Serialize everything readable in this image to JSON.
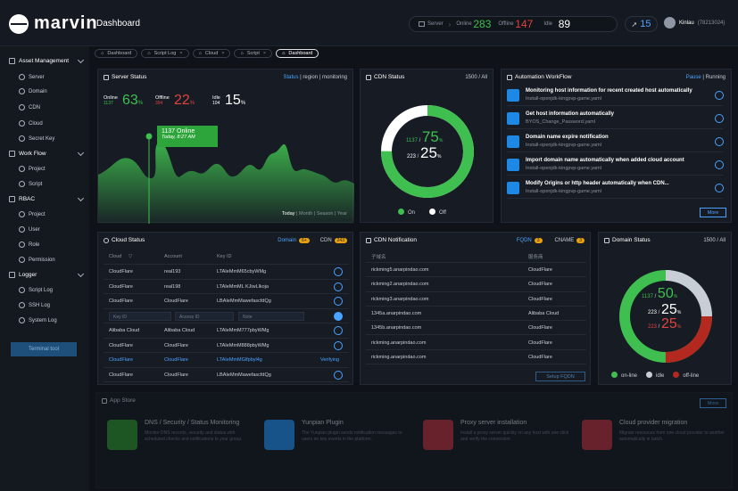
{
  "app": {
    "name": "marvin",
    "page_title": "Dashboard"
  },
  "header": {
    "server_label": "Server",
    "online_label": "Online",
    "online": "283",
    "offline_label": "Offline",
    "offline": "147",
    "idle_label": "Idle",
    "idle": "89",
    "notifications": "15",
    "user_name": "Kinlau",
    "user_phone": "(78213024)"
  },
  "sidebar": {
    "items": [
      {
        "label": "Asset Management",
        "group": true
      },
      {
        "label": "Server"
      },
      {
        "label": "Domain"
      },
      {
        "label": "CDN"
      },
      {
        "label": "Cloud"
      },
      {
        "label": "Secret Key"
      },
      {
        "label": "Work Flow",
        "group": true
      },
      {
        "label": "Project"
      },
      {
        "label": "Script"
      },
      {
        "label": "RBAC",
        "group": true
      },
      {
        "label": "Project"
      },
      {
        "label": "User"
      },
      {
        "label": "Role"
      },
      {
        "label": "Permission"
      },
      {
        "label": "Logger",
        "group": true
      },
      {
        "label": "Script Log"
      },
      {
        "label": "SSH Log"
      },
      {
        "label": "System Log"
      }
    ],
    "terminal_button": "Terminal tool"
  },
  "tabs": [
    {
      "label": "Dashboard"
    },
    {
      "label": "Script Log"
    },
    {
      "label": "Cloud"
    },
    {
      "label": "Script"
    },
    {
      "label": "Dashboard"
    }
  ],
  "server_status": {
    "title": "Server Status",
    "links": {
      "status": "Status",
      "region": "region",
      "monitoring": "monitoring"
    },
    "online": {
      "label": "Online",
      "count": "1137",
      "pct": "63"
    },
    "offline": {
      "label": "Offline",
      "count": "394",
      "pct": "22"
    },
    "idle": {
      "label": "Idle",
      "count": "104",
      "pct": "15"
    },
    "callout_value": "1137 Online",
    "callout_time": "Today, 8:27 AM",
    "ranges": {
      "today": "Today",
      "month": "Month",
      "season": "Season",
      "year": "Year"
    }
  },
  "cdn_status": {
    "title": "CDN Status",
    "count": "1500 / All",
    "on_count": "1137",
    "on_pct": "75",
    "off_count": "223",
    "off_pct": "25",
    "on_label": "On",
    "off_label": "Off",
    "on_fraction": 0.75
  },
  "automation": {
    "title": "Automation WorkFlow",
    "pause": "Pause",
    "running": "Running",
    "more": "More",
    "items": [
      {
        "title": "Monitoring host information for recent created host automatically",
        "script": "Install-openjdk-kingpvp-game.yaml"
      },
      {
        "title": "Get host information automatically",
        "script": "BYOS_Change_Password.yaml"
      },
      {
        "title": "Domain name expire notification",
        "script": "Install-openjdk-kingpvp-game.yaml"
      },
      {
        "title": "Import domain name automatically when added cloud account",
        "script": "Install-openjdk-kingpvp-game.yaml"
      },
      {
        "title": "Modify Origins or http header automatically when CDN...",
        "script": "Install-openjdk-kingpvp-game.yaml"
      }
    ]
  },
  "cloud_status": {
    "title": "Cloud Status",
    "domain": "Domain",
    "domain_badge": "6+",
    "cdn": "CDN",
    "cdn_badge": "243",
    "headers": {
      "cloud": "Cloud",
      "account": "Account",
      "key": "Key ID"
    },
    "rows": [
      {
        "cloud": "CloudFlare",
        "account": "real193",
        "key": "LTAIeMmM65cbyWMg"
      },
      {
        "cloud": "CloudFlare",
        "account": "real198",
        "key": "LTAIeMmML KJiwLlkoja"
      },
      {
        "cloud": "CloudFlare",
        "account": "CloudFlare",
        "key": "LBAIeMmMawefascfdQg"
      },
      {
        "input1": "Key ID",
        "input2": "Access ID",
        "input3": "Note"
      },
      {
        "cloud": "Alibaba Cloud",
        "account": "Alibaba Cloud",
        "key": "LTAIeMmM777pbyWMg"
      },
      {
        "cloud": "CloudFlare",
        "account": "CloudFlare",
        "key": "LTAIeMmM888pbyWMg"
      },
      {
        "cloud": "CloudFlare",
        "account": "CloudFlare",
        "key": "LTAIeMmMGlfpbyl4g",
        "status": "Verifying"
      },
      {
        "cloud": "CloudFlare",
        "account": "CloudFlare",
        "key": "LBAIeMmMawefascfdQg"
      }
    ]
  },
  "cdn_notification": {
    "title": "CDN Notification",
    "fqdn": "FQDN",
    "fqdn_badge": "3",
    "cname": "CNAME",
    "cname_badge": "3",
    "headers": {
      "domain": "子域名",
      "provider": "服务商"
    },
    "rows": [
      {
        "domain": "rickming5.anarpindao.com",
        "provider": "CloudFlare"
      },
      {
        "domain": "rickming2.anarpindao.com",
        "provider": "CloudFlare"
      },
      {
        "domain": "rickming3.anarpindao.com",
        "provider": "CloudFlare"
      },
      {
        "domain": "1345a.anarpindao.com",
        "provider": "Alibaba Cloud"
      },
      {
        "domain": "1345b.anarpindao.com",
        "provider": "CloudFlare"
      },
      {
        "domain": "rickming.anarpindao.com",
        "provider": "CloudFlare"
      },
      {
        "domain": "rickming.anarpindao.com",
        "provider": "CloudFlare"
      }
    ],
    "setup_button": "Setup FQDN"
  },
  "domain_status": {
    "title": "Domain Status",
    "count": "1500 / All",
    "online_count": "1137",
    "online_pct": "50",
    "idle_count": "223",
    "idle_pct": "25",
    "offline_count": "223",
    "offline_pct": "25",
    "online_label": "on-line",
    "idle_label": "idle",
    "offline_label": "off-line"
  },
  "app_store": {
    "title": "App Store",
    "more": "More",
    "apps": [
      {
        "name": "DNS / Security / Status Monitoring",
        "desc": "Monitor DNS records, security and status with scheduled checks and notifications to your group."
      },
      {
        "name": "Yunpian Plugin",
        "desc": "The Yunpian plugin sends notification messages to users on key events in the platform."
      },
      {
        "name": "Proxy server installation",
        "desc": "Install a proxy server quickly on any host with one click and verify the connection."
      },
      {
        "name": "Cloud provider migration",
        "desc": "Migrate resources from one cloud provider to another automatically in batch."
      }
    ]
  },
  "colors": {
    "green": "#3fbf4f",
    "red": "#e0433e",
    "blue": "#4aa3ff",
    "orange": "#e8a10c",
    "white": "#ffffff",
    "grey": "#8e97a3"
  }
}
